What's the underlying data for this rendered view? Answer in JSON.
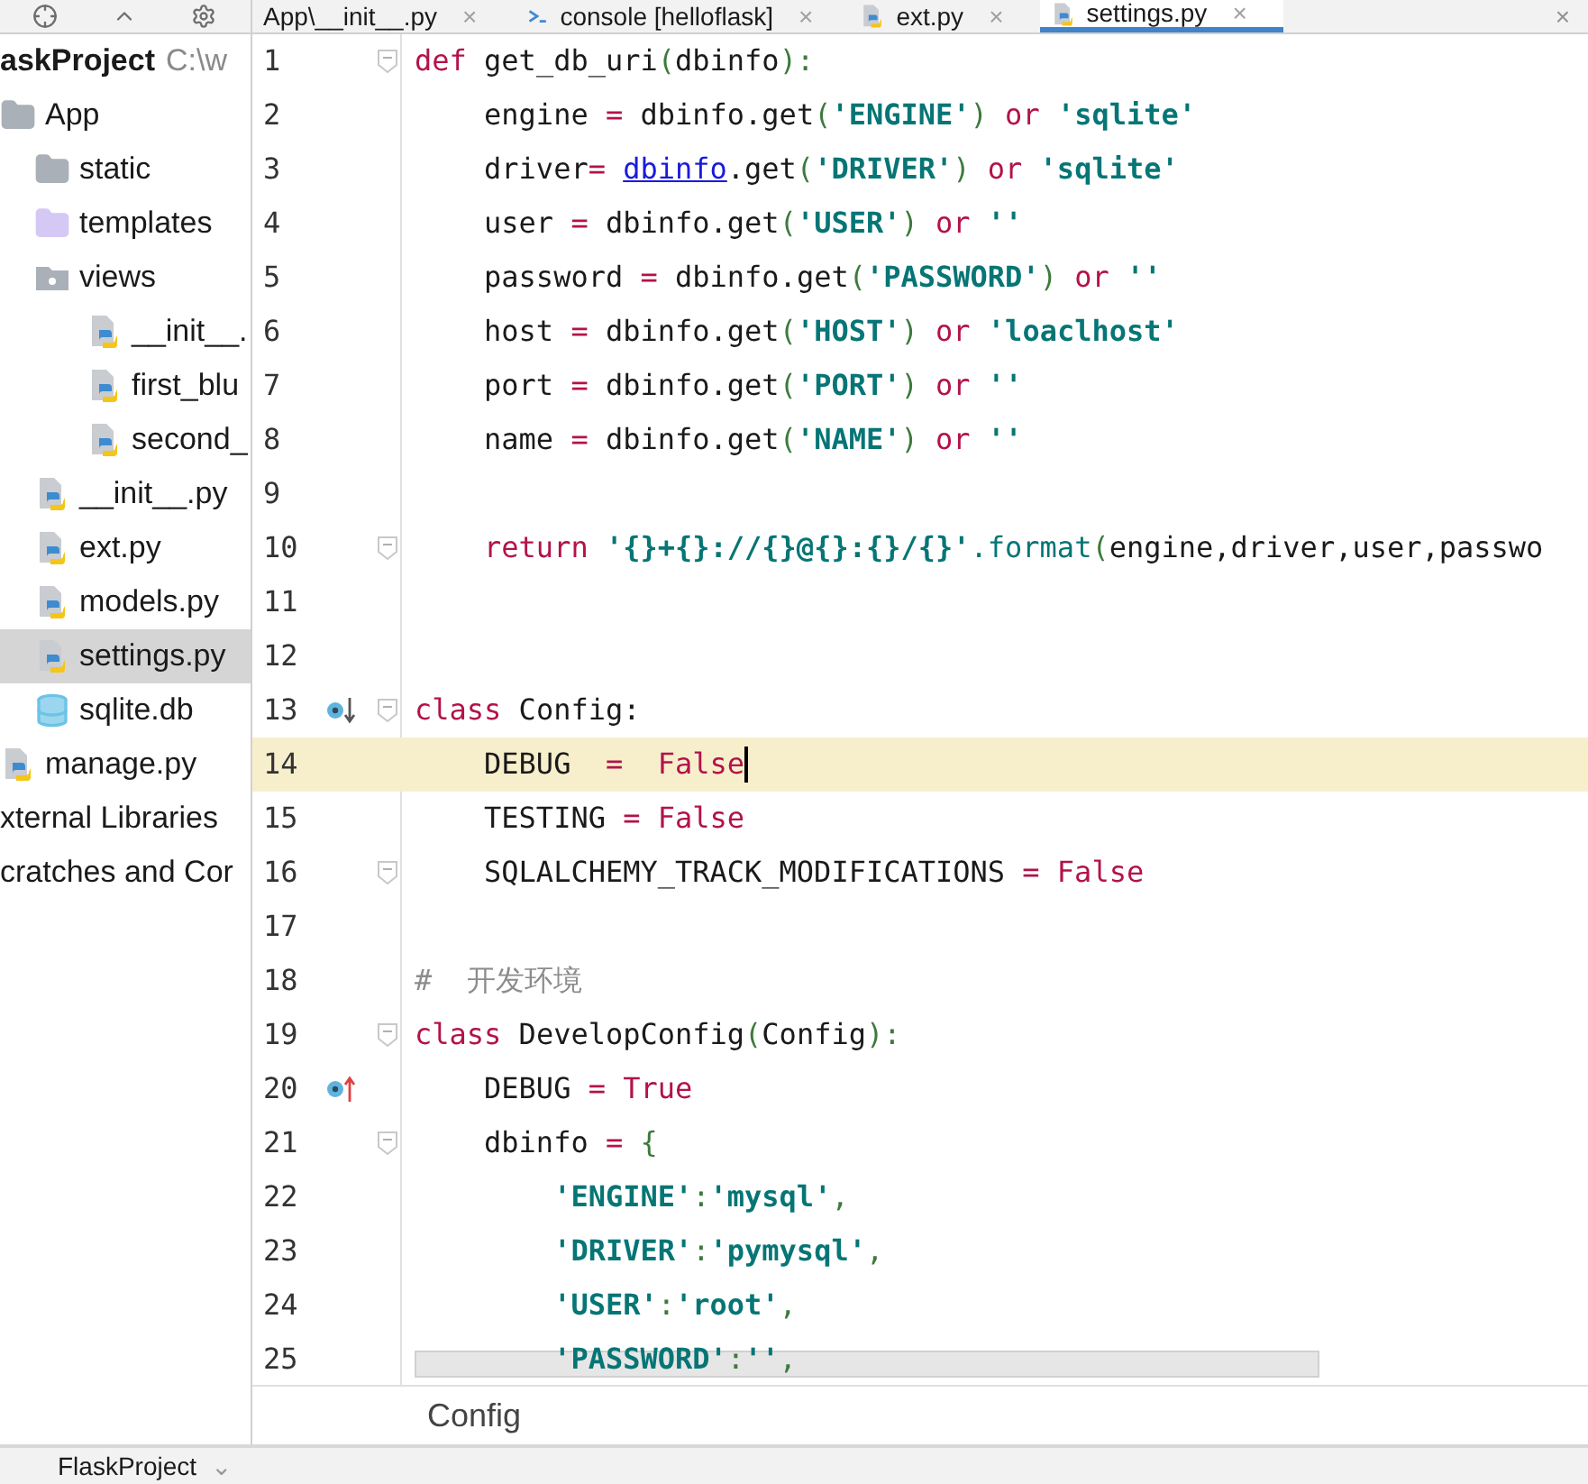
{
  "tabs": [
    {
      "label": "App\\__init__.py",
      "kind": "plain",
      "close": "×",
      "selected": false
    },
    {
      "label": "console [helloflask]",
      "kind": "console",
      "close": "×",
      "selected": false
    },
    {
      "label": "ext.py",
      "kind": "python",
      "close": "×",
      "selected": false
    },
    {
      "label": "settings.py",
      "kind": "python",
      "close": "×",
      "selected": true
    }
  ],
  "tab_overflow": "×",
  "project": {
    "name": "askProject",
    "path": "C:\\w",
    "children": [
      {
        "label": "App",
        "kind": "folder",
        "selected": false,
        "children": [
          {
            "label": "static",
            "kind": "folder",
            "selected": false
          },
          {
            "label": "templates",
            "kind": "template-folder",
            "selected": false
          },
          {
            "label": "views",
            "kind": "package",
            "selected": false,
            "children": [
              {
                "label": "__init__.",
                "kind": "python",
                "selected": false
              },
              {
                "label": "first_blu",
                "kind": "python",
                "selected": false
              },
              {
                "label": "second_",
                "kind": "python",
                "selected": false
              }
            ]
          },
          {
            "label": "__init__.py",
            "kind": "python",
            "selected": false
          },
          {
            "label": "ext.py",
            "kind": "python",
            "selected": false
          },
          {
            "label": "models.py",
            "kind": "python",
            "selected": false
          },
          {
            "label": "settings.py",
            "kind": "python",
            "selected": true
          },
          {
            "label": "sqlite.db",
            "kind": "database",
            "selected": false
          }
        ]
      },
      {
        "label": "manage.py",
        "kind": "python",
        "selected": false
      }
    ]
  },
  "roots": [
    {
      "label": "xternal Libraries"
    },
    {
      "label": "cratches and Cor"
    }
  ],
  "code": [
    {
      "number": "1",
      "fold": true,
      "tokens": [
        {
          "kind": "kw",
          "t": "def"
        },
        {
          "kind": "id",
          "t": " get_db_uri"
        },
        {
          "kind": "p",
          "t": "("
        },
        {
          "kind": "id",
          "t": "dbinfo"
        },
        {
          "kind": "p",
          "t": "):"
        }
      ]
    },
    {
      "number": "2",
      "tokens": [
        {
          "kind": "id",
          "t": "    engine "
        },
        {
          "kind": "op",
          "t": "="
        },
        {
          "kind": "id",
          "t": " dbinfo.get"
        },
        {
          "kind": "p",
          "t": "("
        },
        {
          "kind": "str",
          "t": "'ENGINE'"
        },
        {
          "kind": "p",
          "t": ")"
        },
        {
          "kind": "kw",
          "t": " or "
        },
        {
          "kind": "str",
          "t": "'sqlite'"
        }
      ]
    },
    {
      "number": "3",
      "tokens": [
        {
          "kind": "id",
          "t": "    driver"
        },
        {
          "kind": "op",
          "t": "= "
        },
        {
          "kind": "link",
          "t": "dbinfo"
        },
        {
          "kind": "id",
          "t": ".get"
        },
        {
          "kind": "p",
          "t": "("
        },
        {
          "kind": "str",
          "t": "'DRIVER'"
        },
        {
          "kind": "p",
          "t": ")"
        },
        {
          "kind": "kw",
          "t": " or "
        },
        {
          "kind": "str",
          "t": "'sqlite'"
        }
      ]
    },
    {
      "number": "4",
      "tokens": [
        {
          "kind": "id",
          "t": "    user "
        },
        {
          "kind": "op",
          "t": "="
        },
        {
          "kind": "id",
          "t": " dbinfo.get"
        },
        {
          "kind": "p",
          "t": "("
        },
        {
          "kind": "str",
          "t": "'USER'"
        },
        {
          "kind": "p",
          "t": ")"
        },
        {
          "kind": "kw",
          "t": " or "
        },
        {
          "kind": "str",
          "t": "''"
        }
      ]
    },
    {
      "number": "5",
      "tokens": [
        {
          "kind": "id",
          "t": "    password "
        },
        {
          "kind": "op",
          "t": "="
        },
        {
          "kind": "id",
          "t": " dbinfo.get"
        },
        {
          "kind": "p",
          "t": "("
        },
        {
          "kind": "str",
          "t": "'PASSWORD'"
        },
        {
          "kind": "p",
          "t": ")"
        },
        {
          "kind": "kw",
          "t": " or "
        },
        {
          "kind": "str",
          "t": "''"
        }
      ]
    },
    {
      "number": "6",
      "tokens": [
        {
          "kind": "id",
          "t": "    host "
        },
        {
          "kind": "op",
          "t": "="
        },
        {
          "kind": "id",
          "t": " dbinfo.get"
        },
        {
          "kind": "p",
          "t": "("
        },
        {
          "kind": "str",
          "t": "'HOST'"
        },
        {
          "kind": "p",
          "t": ")"
        },
        {
          "kind": "kw",
          "t": " or "
        },
        {
          "kind": "str",
          "t": "'loaclhost'"
        }
      ]
    },
    {
      "number": "7",
      "tokens": [
        {
          "kind": "id",
          "t": "    port "
        },
        {
          "kind": "op",
          "t": "="
        },
        {
          "kind": "id",
          "t": " dbinfo.get"
        },
        {
          "kind": "p",
          "t": "("
        },
        {
          "kind": "str",
          "t": "'PORT'"
        },
        {
          "kind": "p",
          "t": ")"
        },
        {
          "kind": "kw",
          "t": " or "
        },
        {
          "kind": "str",
          "t": "''"
        }
      ]
    },
    {
      "number": "8",
      "tokens": [
        {
          "kind": "id",
          "t": "    name "
        },
        {
          "kind": "op",
          "t": "="
        },
        {
          "kind": "id",
          "t": " dbinfo.get"
        },
        {
          "kind": "p",
          "t": "("
        },
        {
          "kind": "str",
          "t": "'NAME'"
        },
        {
          "kind": "p",
          "t": ")"
        },
        {
          "kind": "kw",
          "t": " or "
        },
        {
          "kind": "str",
          "t": "''"
        }
      ]
    },
    {
      "number": "9"
    },
    {
      "number": "10",
      "fold": true,
      "tokens": [
        {
          "kind": "kw",
          "t": "    return "
        },
        {
          "kind": "str",
          "t": "'{}+{}://{}@{}:{}/{}'"
        },
        {
          "kind": "fn",
          "t": ".format"
        },
        {
          "kind": "p",
          "t": "("
        },
        {
          "kind": "id",
          "t": "engine,driver,user,passwo"
        }
      ]
    },
    {
      "number": "11"
    },
    {
      "number": "12"
    },
    {
      "number": "13",
      "fold": true,
      "marker": {
        "kind": "down"
      },
      "tokens": [
        {
          "kind": "kw",
          "t": "class"
        },
        {
          "kind": "id",
          "t": " Config:"
        }
      ]
    },
    {
      "number": "14",
      "current": true,
      "tokens": [
        {
          "kind": "id",
          "t": "    DEBUG  "
        },
        {
          "kind": "op",
          "t": "=  "
        },
        {
          "kind": "bool",
          "t": "False"
        }
      ]
    },
    {
      "number": "15",
      "tokens": [
        {
          "kind": "id",
          "t": "    TESTING "
        },
        {
          "kind": "op",
          "t": "= "
        },
        {
          "kind": "bool",
          "t": "False"
        }
      ]
    },
    {
      "number": "16",
      "fold": true,
      "tokens": [
        {
          "kind": "id",
          "t": "    SQLALCHEMY_TRACK_MODIFICATIONS "
        },
        {
          "kind": "op",
          "t": "= "
        },
        {
          "kind": "bool",
          "t": "False"
        }
      ]
    },
    {
      "number": "17"
    },
    {
      "number": "18",
      "tokens": [
        {
          "kind": "comment",
          "t": "#  开发环境"
        }
      ]
    },
    {
      "number": "19",
      "fold": true,
      "tokens": [
        {
          "kind": "kw",
          "t": "class"
        },
        {
          "kind": "id",
          "t": " DevelopConfig"
        },
        {
          "kind": "p",
          "t": "("
        },
        {
          "kind": "id",
          "t": "Config"
        },
        {
          "kind": "p",
          "t": "):"
        }
      ]
    },
    {
      "number": "20",
      "marker": {
        "kind": "up"
      },
      "tokens": [
        {
          "kind": "id",
          "t": "    DEBUG "
        },
        {
          "kind": "op",
          "t": "= "
        },
        {
          "kind": "bool",
          "t": "True"
        }
      ]
    },
    {
      "number": "21",
      "fold": true,
      "tokens": [
        {
          "kind": "id",
          "t": "    dbinfo "
        },
        {
          "kind": "op",
          "t": "="
        },
        {
          "kind": "p",
          "t": " {"
        }
      ]
    },
    {
      "number": "22",
      "tokens": [
        {
          "kind": "str",
          "t": "        'ENGINE'"
        },
        {
          "kind": "p",
          "t": ":"
        },
        {
          "kind": "str",
          "t": "'mysql'"
        },
        {
          "kind": "p",
          "t": ","
        }
      ]
    },
    {
      "number": "23",
      "tokens": [
        {
          "kind": "str",
          "t": "        'DRIVER'"
        },
        {
          "kind": "p",
          "t": ":"
        },
        {
          "kind": "str",
          "t": "'pymysql'"
        },
        {
          "kind": "p",
          "t": ","
        }
      ]
    },
    {
      "number": "24",
      "tokens": [
        {
          "kind": "str",
          "t": "        'USER'"
        },
        {
          "kind": "p",
          "t": ":"
        },
        {
          "kind": "str",
          "t": "'root'"
        },
        {
          "kind": "p",
          "t": ","
        }
      ]
    },
    {
      "number": "25",
      "tokens": [
        {
          "kind": "str",
          "t": "        'PASSWORD'"
        },
        {
          "kind": "p",
          "t": ":"
        },
        {
          "kind": "str",
          "t": "''"
        },
        {
          "kind": "p",
          "t": ","
        }
      ]
    }
  ],
  "breadcrumb": "Config",
  "bottom_tab": {
    "label": "FlaskProject",
    "caret": "⌄"
  }
}
